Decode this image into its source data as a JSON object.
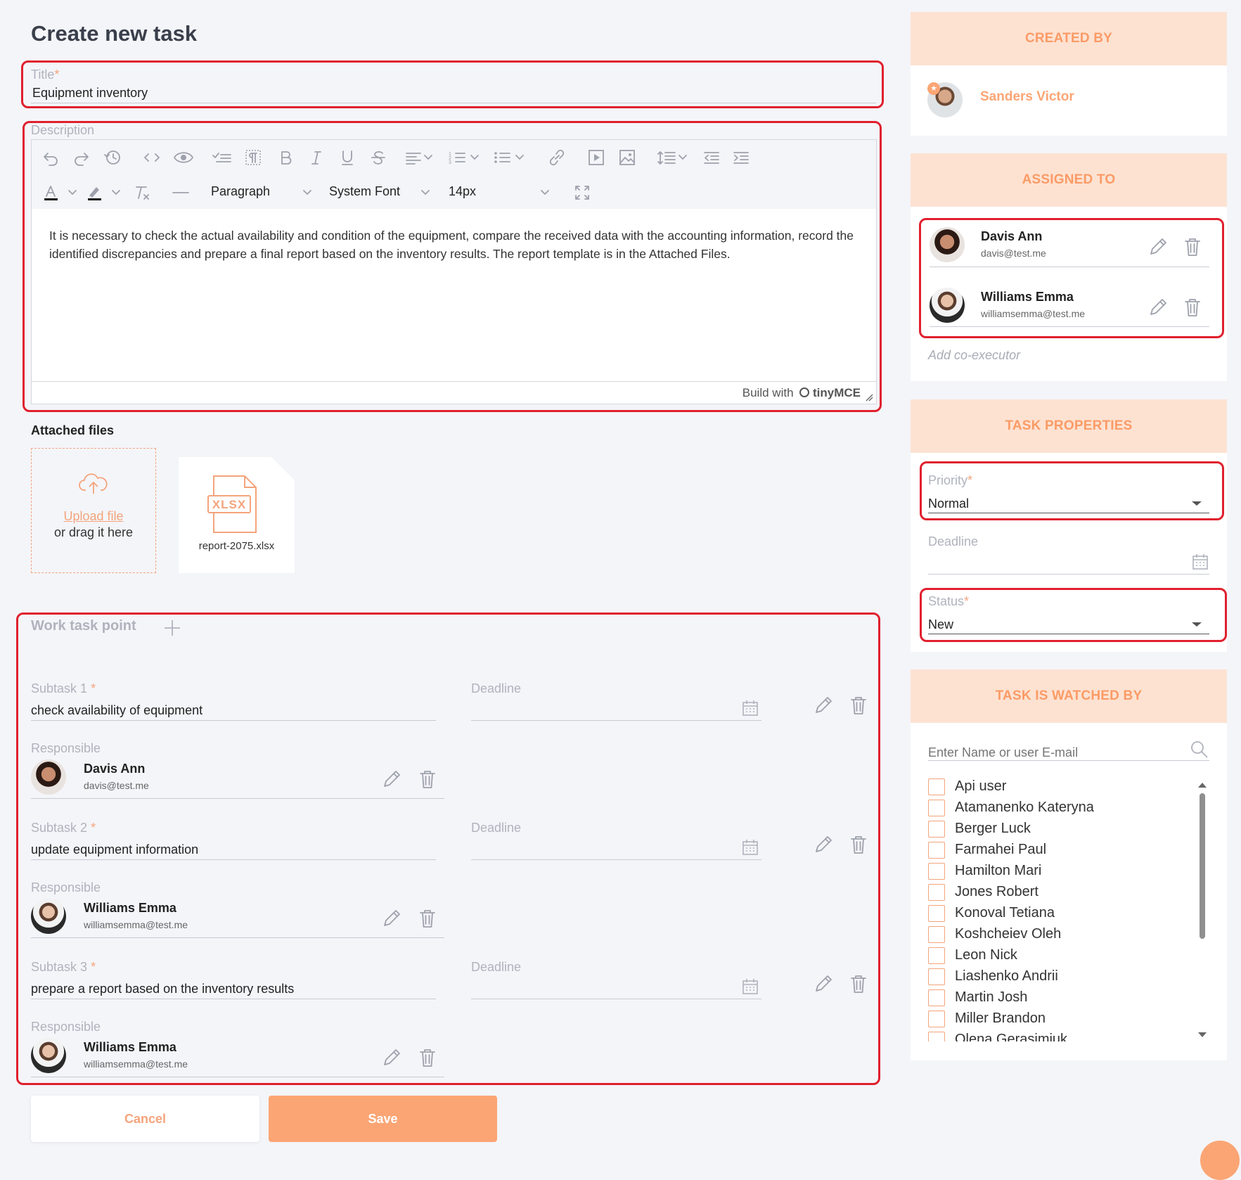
{
  "page": {
    "title": "Create new task"
  },
  "title_field": {
    "label": "Title",
    "value": "Equipment inventory"
  },
  "description": {
    "label": "Description",
    "format_select": "Paragraph",
    "font_select": "System Font",
    "size_select": "14px",
    "text": "It is necessary to check the actual availability and condition of the equipment, compare the received data with the accounting information, record the identified discrepancies and prepare a final report based on the inventory results. The report template is in the Attached Files.",
    "footer_prefix": "Build with",
    "footer_brand": "tinyMCE"
  },
  "attached": {
    "label": "Attached files",
    "upload_link": "Upload file",
    "upload_hint": "or drag it here",
    "files": [
      {
        "badge": "XLSX",
        "name": "report-2075.xlsx"
      }
    ]
  },
  "work": {
    "label": "Work task point",
    "responsible_label": "Responsible",
    "deadline_label": "Deadline",
    "subtasks": [
      {
        "label": "Subtask 1",
        "value": "check availability of equipment",
        "responsible": {
          "name": "Davis Ann",
          "email": "davis@test.me"
        }
      },
      {
        "label": "Subtask 2",
        "value": "update equipment information",
        "responsible": {
          "name": "Williams Emma",
          "email": "williamsemma@test.me"
        }
      },
      {
        "label": "Subtask 3",
        "value": "prepare a report based on the inventory results",
        "responsible": {
          "name": "Williams Emma",
          "email": "williamsemma@test.me"
        }
      }
    ]
  },
  "buttons": {
    "cancel": "Cancel",
    "save": "Save"
  },
  "created_by": {
    "header": "CREATED BY",
    "name": "Sanders Victor"
  },
  "assigned_to": {
    "header": "ASSIGNED TO",
    "people": [
      {
        "name": "Davis Ann",
        "email": "davis@test.me"
      },
      {
        "name": "Williams Emma",
        "email": "williamsemma@test.me"
      }
    ],
    "add_label": "Add co-executor"
  },
  "properties": {
    "header": "TASK PROPERTIES",
    "priority": {
      "label": "Priority",
      "value": "Normal"
    },
    "deadline": {
      "label": "Deadline"
    },
    "status": {
      "label": "Status",
      "value": "New"
    }
  },
  "watched": {
    "header": "TASK IS WATCHED BY",
    "search_placeholder": "Enter Name or user E-mail",
    "users": [
      "Api user",
      "Atamanenko Kateryna",
      "Berger Luck",
      "Farmahei Paul",
      "Hamilton Mari",
      "Jones Robert",
      "Konoval Tetiana",
      "Koshcheiev Oleh",
      "Leon Nick",
      "Liashenko Andrii",
      "Martin Josh",
      "Miller Brandon",
      "Olena Gerasimiuk"
    ]
  },
  "colors": {
    "accent": "#fba574",
    "highlight": "#e0202e",
    "panel_head_bg": "#fde2d2"
  }
}
